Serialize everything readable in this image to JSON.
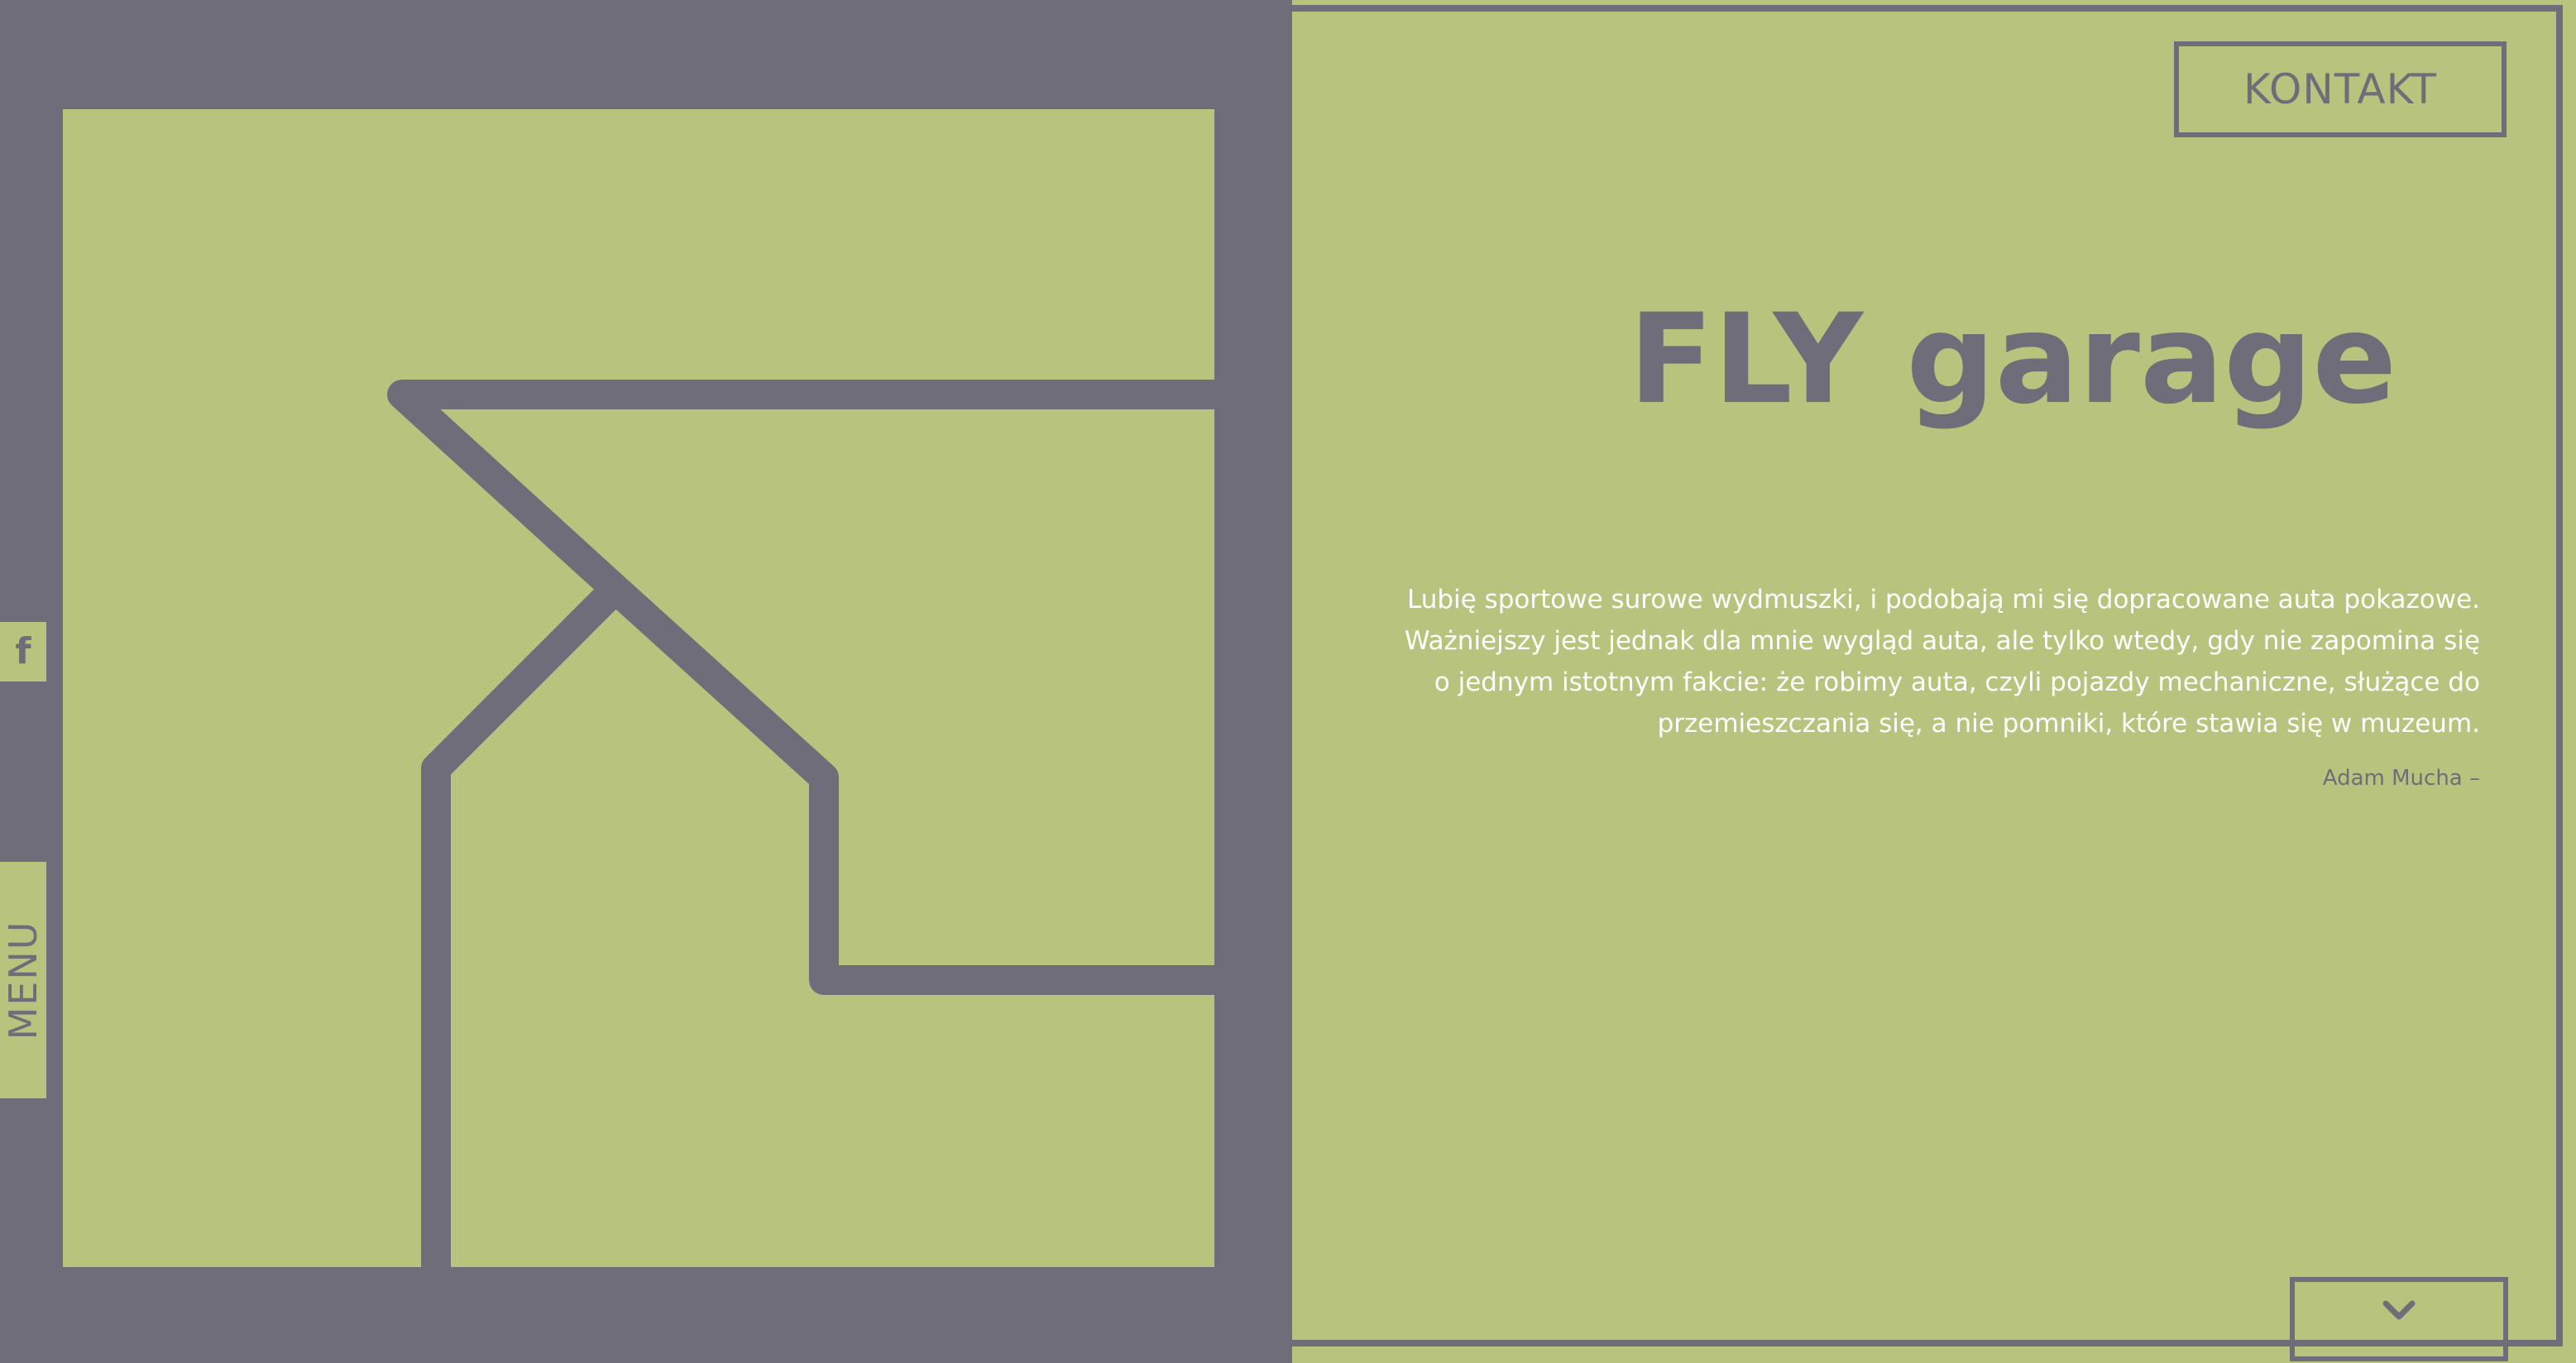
{
  "brand": {
    "title": "FLY garage",
    "logo_icon": "fly-garage-logo-icon"
  },
  "colors": {
    "accent_green": "#b8c47d",
    "dark_gray": "#6f6d79",
    "white": "#ffffff"
  },
  "side_tabs": {
    "facebook_label": "f",
    "facebook_icon": "facebook-icon",
    "menu_label": "MENU"
  },
  "header": {
    "contact_label": "KONTAKT"
  },
  "quote": {
    "lines": [
      "Lubię sportowe surowe wydmuszki, i podobają mi się dopracowane auta pokazowe.",
      "Ważniejszy jest jednak dla mnie wygląd auta, ale tylko wtedy, gdy nie zapomina się",
      "o jednym istotnym fakcie: że robimy auta, czyli pojazdy mechaniczne, służące do",
      "przemieszczania się, a nie pomniki, które stawia się w muzeum."
    ],
    "author": "Adam Mucha –"
  },
  "scroll": {
    "icon": "chevron-down-icon"
  }
}
